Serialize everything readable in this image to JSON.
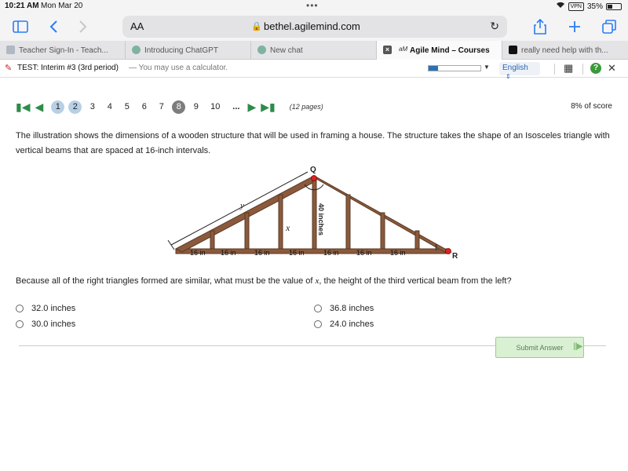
{
  "status": {
    "time": "10:21 AM",
    "date": "Mon Mar 20",
    "vpn": "VPN",
    "battery": "35%"
  },
  "browser": {
    "aa": "AA",
    "url": "bethel.agilemind.com",
    "tabs": [
      {
        "label": "Teacher Sign-In - Teach..."
      },
      {
        "label": "Introducing ChatGPT"
      },
      {
        "label": "New chat"
      },
      {
        "label": "Agile Mind – Courses",
        "icon_text": "aM"
      },
      {
        "label": "really need help with th..."
      }
    ]
  },
  "testbar": {
    "title": "TEST: Interim #3 (3rd period)",
    "note": "— You may use a calculator.",
    "language": "English",
    "progress_fraction": 0.18
  },
  "pager": {
    "pages": [
      "1",
      "2",
      "3",
      "4",
      "5",
      "6",
      "7",
      "8",
      "9",
      "10"
    ],
    "ellipsis": "...",
    "count": "(12 pages)",
    "score": "8% of score"
  },
  "question": {
    "intro": "The illustration shows the dimensions of a wooden structure that will be used in framing a house. The structure takes the shape of an Isosceles triangle with vertical beams that are spaced at 16-inch intervals.",
    "prompt_before": "Because all of the right triangles formed are similar, what must be the value of ",
    "prompt_var": "x",
    "prompt_after": ", the height of the third vertical beam from the left?"
  },
  "diagram": {
    "point_q": "Q",
    "point_r": "R",
    "label_y": "y",
    "label_x": "x",
    "height_label": "40 inches",
    "spacing_label": "16 in"
  },
  "choices": [
    {
      "label": "32.0 inches"
    },
    {
      "label": "36.8 inches"
    },
    {
      "label": "30.0 inches"
    },
    {
      "label": "24.0 inches"
    }
  ],
  "submit_label": "Submit Answer",
  "colors": {
    "wood": "#8b5a3c",
    "accent_green": "#2e8b4a",
    "submit_bg": "#d9f0d2"
  }
}
